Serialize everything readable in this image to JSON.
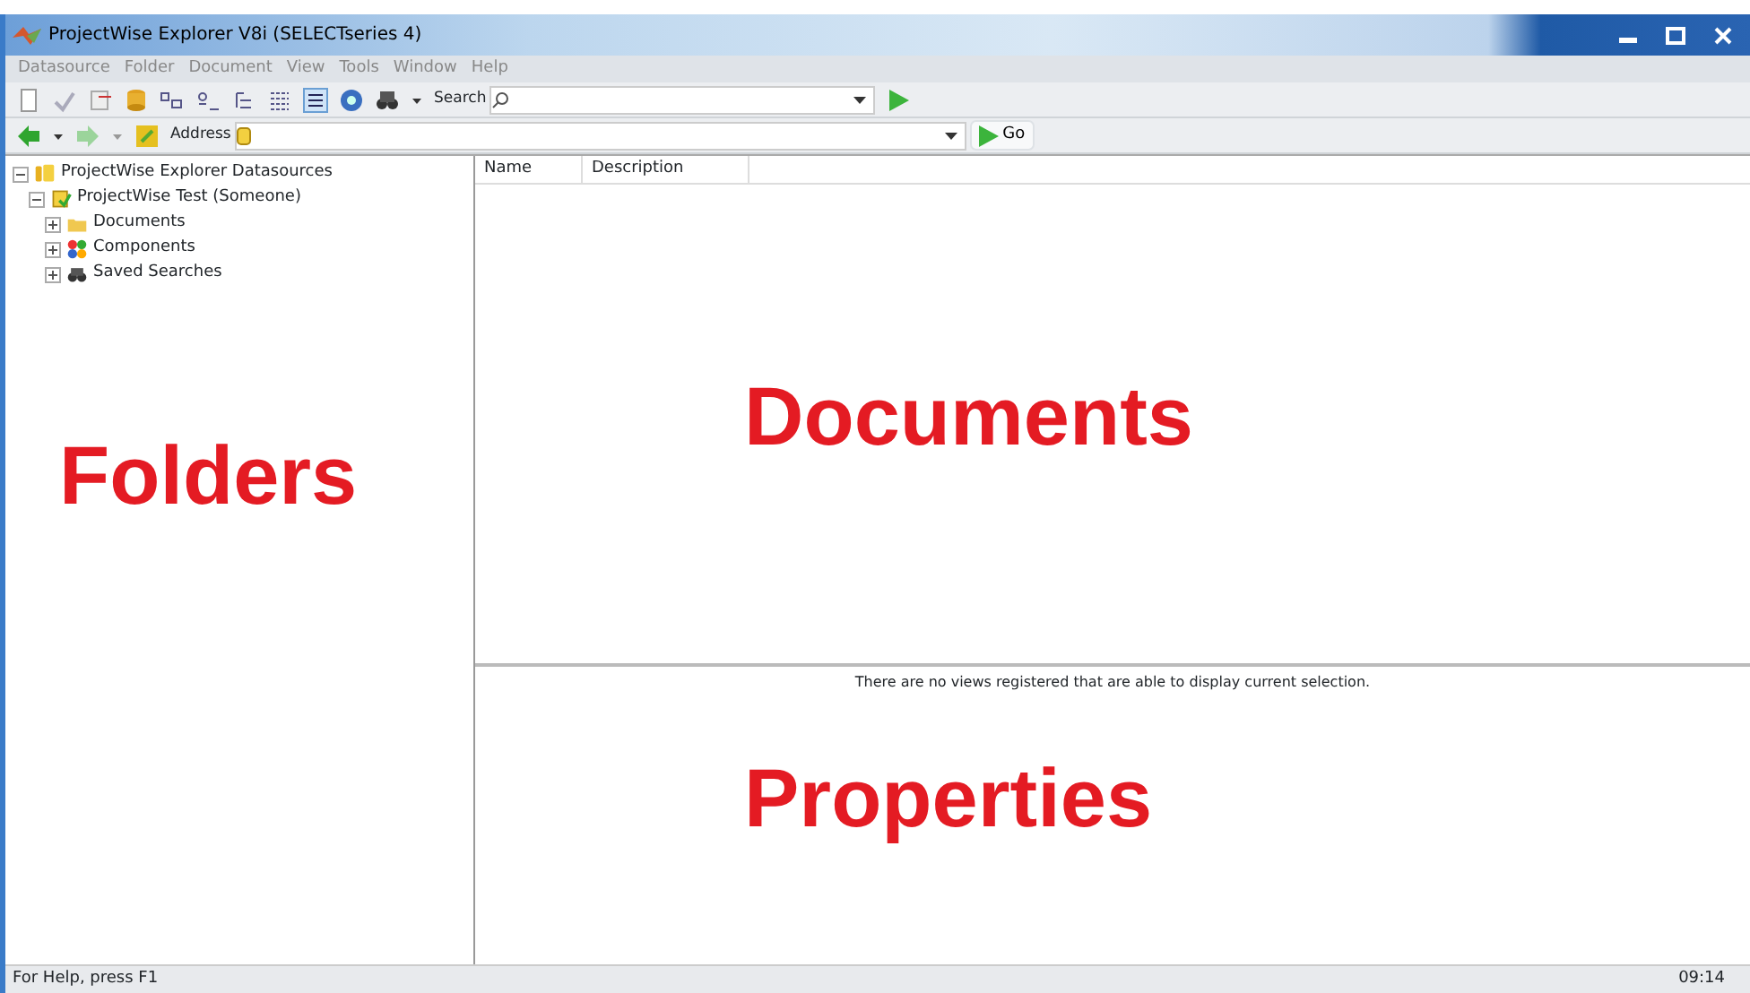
{
  "window": {
    "title": "ProjectWise Explorer V8i (SELECTseries 4)"
  },
  "menu": [
    "Datasource",
    "Folder",
    "Document",
    "View",
    "Tools",
    "Window",
    "Help"
  ],
  "toolbar": {
    "search_label": "Search"
  },
  "address_bar": {
    "label": "Address",
    "go": "Go"
  },
  "tree": [
    {
      "label": "ProjectWise Explorer Datasources",
      "kind": "root",
      "expanded": true,
      "children": [
        {
          "label": "ProjectWise Test (Someone)",
          "kind": "datasource",
          "expanded": true,
          "children": [
            {
              "label": "Documents",
              "kind": "folder",
              "expanded": false
            },
            {
              "label": "Components",
              "kind": "components",
              "expanded": false
            },
            {
              "label": "Saved Searches",
              "kind": "searches",
              "expanded": false
            }
          ]
        }
      ]
    }
  ],
  "columns": [
    "Name",
    "Description"
  ],
  "overlays": {
    "folders": "Folders",
    "documents": "Documents",
    "properties": "Properties"
  },
  "properties_message": "There are no views registered that are able to display current selection.",
  "status_bar": {
    "help": "For Help, press F1",
    "time": "09:14"
  }
}
